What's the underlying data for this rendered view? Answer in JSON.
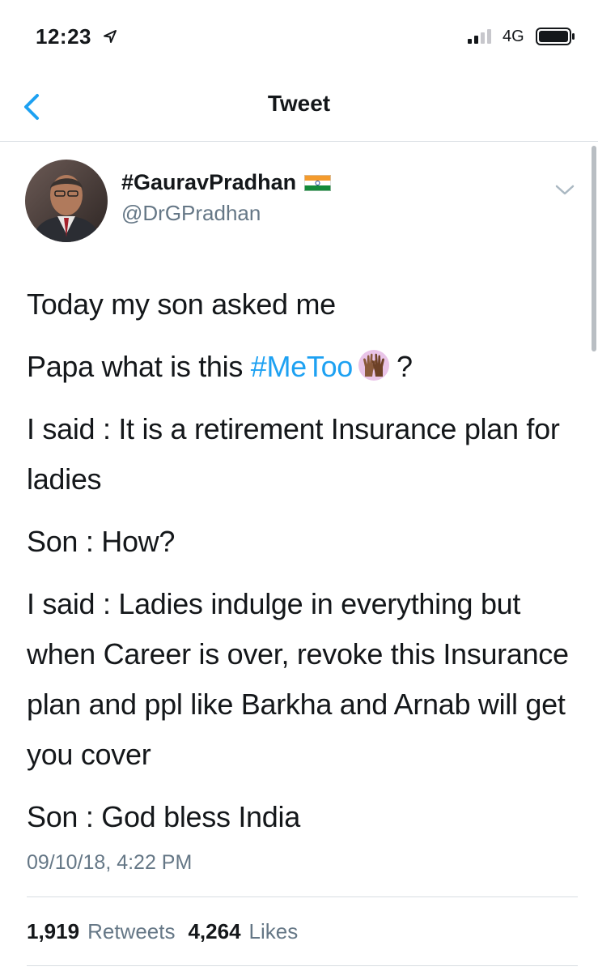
{
  "status_bar": {
    "time": "12:23",
    "network": "4G",
    "icons": [
      "location-arrow-icon",
      "cellular-signal-icon",
      "battery-icon"
    ]
  },
  "nav": {
    "title": "Tweet",
    "back_icon": "chevron-left-icon"
  },
  "tweet": {
    "author": {
      "display_name": "#GauravPradhan",
      "flag_icon": "india-flag-icon",
      "handle": "@DrGPradhan"
    },
    "menu_icon": "chevron-down-icon",
    "lines": {
      "l1": "Today my son asked me",
      "l2_prefix": "Papa what is this ",
      "l2_hashtag": "#MeToo",
      "l2_suffix": "?",
      "l3": "I said : It is a retirement Insurance plan for ladies",
      "l4": "Son : How?",
      "l5": "I said : Ladies indulge in everything but when Career is over, revoke this Insurance plan and ppl like Barkha and Arnab will get you cover",
      "l6": "Son : God bless India"
    },
    "emoji_icon": "raised-hands-icon",
    "timestamp": "09/10/18, 4:22 PM",
    "stats": {
      "retweets_count": "1,919",
      "retweets_label": "Retweets",
      "likes_count": "4,264",
      "likes_label": "Likes"
    }
  },
  "colors": {
    "link": "#1da1f2",
    "secondary_text": "#657786",
    "primary_text": "#14171a",
    "divider": "#d8dde2"
  }
}
